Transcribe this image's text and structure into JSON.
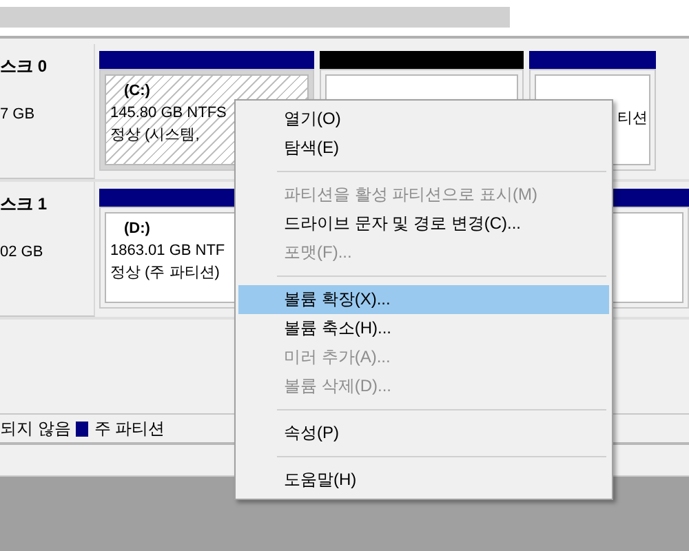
{
  "disks": [
    {
      "name": "스크 0",
      "size": "7 GB",
      "partitions": [
        {
          "kind": "primary",
          "selected": true,
          "letter": "(C:)",
          "size": "145.80 GB NTFS",
          "status": "정상 (시스템,"
        },
        {
          "kind": "unallocated",
          "selected": false
        },
        {
          "kind": "primary",
          "selected": false,
          "status": "티션"
        }
      ]
    },
    {
      "name": "스크 1",
      "size": "02 GB",
      "partitions": [
        {
          "kind": "primary",
          "selected": false,
          "letter": "(D:)",
          "size": "1863.01 GB NTF",
          "status": "정상 (주 파티션)"
        }
      ]
    }
  ],
  "legend": [
    {
      "label": "되지 않음"
    },
    {
      "label": "주 파티션",
      "color": "#000080"
    }
  ],
  "context_menu": [
    {
      "kind": "item",
      "label": "열기(O)",
      "disabled": false,
      "selected": false
    },
    {
      "kind": "item",
      "label": "탐색(E)",
      "disabled": false,
      "selected": false
    },
    {
      "kind": "separator"
    },
    {
      "kind": "item",
      "label": "파티션을 활성 파티션으로 표시(M)",
      "disabled": true,
      "selected": false
    },
    {
      "kind": "item",
      "label": "드라이브 문자 및 경로 변경(C)...",
      "disabled": false,
      "selected": false
    },
    {
      "kind": "item",
      "label": "포맷(F)...",
      "disabled": true,
      "selected": false
    },
    {
      "kind": "separator"
    },
    {
      "kind": "item",
      "label": "볼륨 확장(X)...",
      "disabled": false,
      "selected": true
    },
    {
      "kind": "item",
      "label": "볼륨 축소(H)...",
      "disabled": false,
      "selected": false
    },
    {
      "kind": "item",
      "label": "미러 추가(A)...",
      "disabled": true,
      "selected": false
    },
    {
      "kind": "item",
      "label": "볼륨 삭제(D)...",
      "disabled": true,
      "selected": false
    },
    {
      "kind": "separator"
    },
    {
      "kind": "item",
      "label": "속성(P)",
      "disabled": false,
      "selected": false
    },
    {
      "kind": "separator"
    },
    {
      "kind": "item",
      "label": "도움말(H)",
      "disabled": false,
      "selected": false
    }
  ]
}
